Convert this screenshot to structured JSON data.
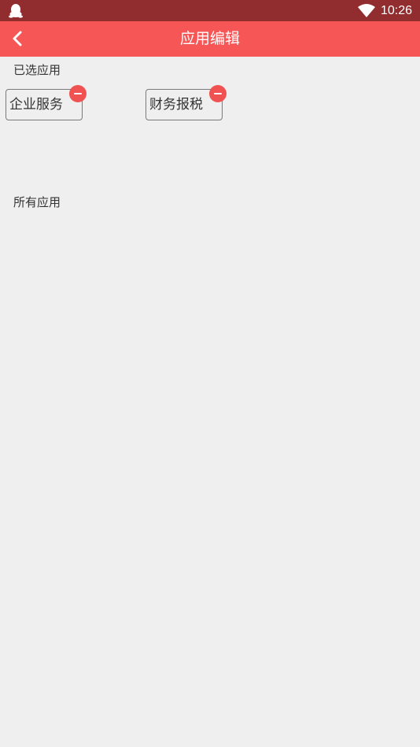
{
  "status_bar": {
    "time": "10:26",
    "left_icon": "qq-penguin-icon",
    "right_icons": [
      "wifi-icon"
    ],
    "background": "#922d2f"
  },
  "app_bar": {
    "title": "应用编辑",
    "back_icon": "chevron-left-icon",
    "background": "#f75656"
  },
  "selected_section": {
    "label": "已选应用",
    "apps": [
      {
        "label": "企业服务",
        "action_icon": "remove-icon"
      },
      {
        "label": "财务报税",
        "action_icon": "remove-icon"
      }
    ]
  },
  "all_section": {
    "label": "所有应用"
  },
  "colors": {
    "accent": "#f75656",
    "remove_badge": "#f05252",
    "page_background": "#efefef"
  }
}
